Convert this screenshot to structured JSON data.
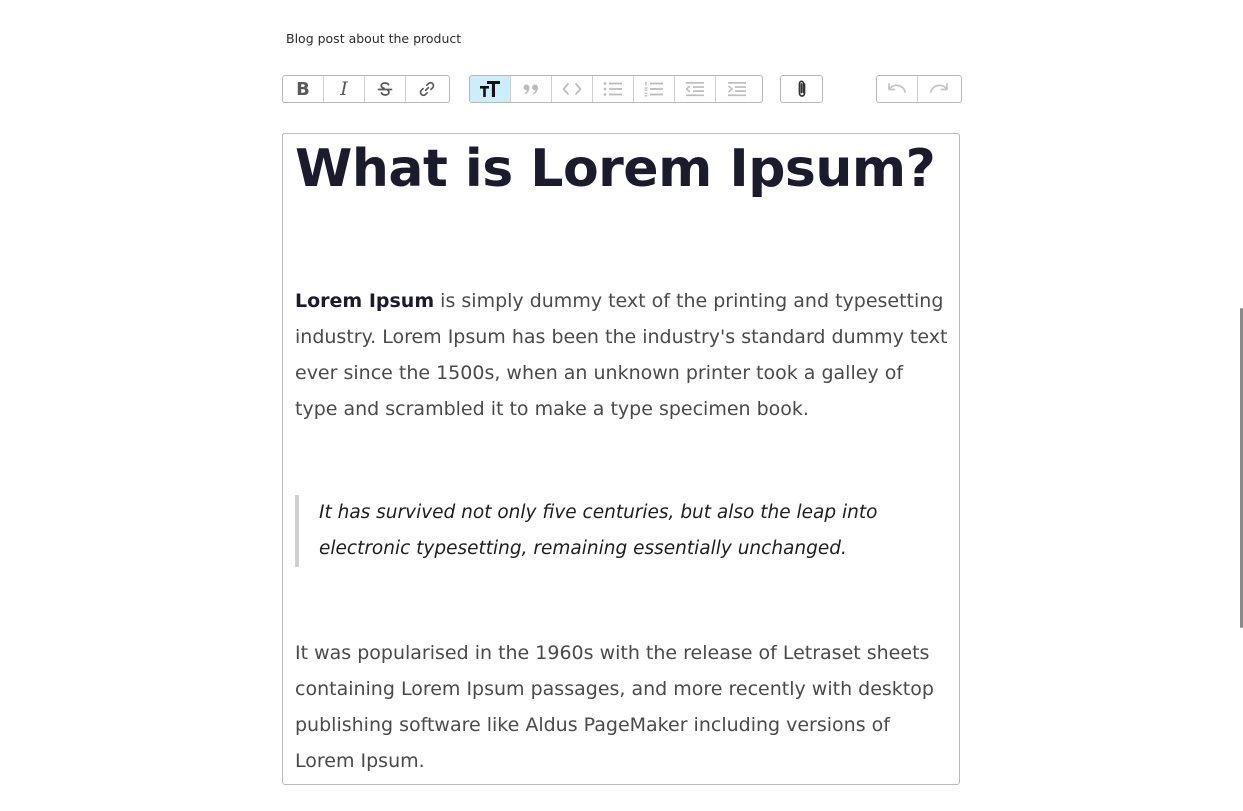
{
  "field": {
    "label": "Blog post about the product"
  },
  "toolbar": {
    "text_formatting": [
      {
        "name": "bold-button",
        "icon": "bold-icon",
        "glyph": "B",
        "active": false
      },
      {
        "name": "italic-button",
        "icon": "italic-icon",
        "glyph": "I",
        "active": false
      },
      {
        "name": "strikethrough-button",
        "icon": "strikethrough-icon",
        "active": false
      },
      {
        "name": "link-button",
        "icon": "link-icon",
        "active": false
      }
    ],
    "block_formatting": [
      {
        "name": "heading-button",
        "icon": "heading-icon",
        "active": true
      },
      {
        "name": "quote-button",
        "icon": "quote-icon",
        "active": false
      },
      {
        "name": "code-button",
        "icon": "code-icon",
        "active": false
      },
      {
        "name": "bullet-list-button",
        "icon": "bullet-list-icon",
        "active": false
      },
      {
        "name": "numbered-list-button",
        "icon": "numbered-list-icon",
        "active": false
      },
      {
        "name": "decrease-indent-button",
        "icon": "outdent-icon",
        "active": false
      },
      {
        "name": "increase-indent-button",
        "icon": "indent-icon",
        "active": false
      }
    ],
    "file_tools": [
      {
        "name": "attach-file-button",
        "icon": "paperclip-icon",
        "active": false
      }
    ],
    "history": [
      {
        "name": "undo-button",
        "icon": "undo-icon",
        "active": false
      },
      {
        "name": "redo-button",
        "icon": "redo-icon",
        "active": false
      }
    ]
  },
  "content": {
    "heading": "What is Lorem Ipsum?",
    "intro_bold": "Lorem Ipsum",
    "intro_rest": " is simply dummy text of the printing and typesetting industry. Lorem Ipsum has been the industry's standard dummy text ever since the 1500s, when an unknown printer took a galley of type and scrambled it to make a type specimen book.",
    "quote": "It has survived not only five centuries, but also the leap into electronic typesetting, remaining essentially unchanged.",
    "closing": "It was popularised in the 1960s with the release of Letraset sheets containing Lorem Ipsum passages, and more recently with desktop publishing software like Aldus PageMaker including versions of Lorem Ipsum."
  },
  "colors": {
    "active_button_bg": "#cbeefa",
    "heading": "#1a1b2c",
    "body_text": "#4a4a4a"
  }
}
